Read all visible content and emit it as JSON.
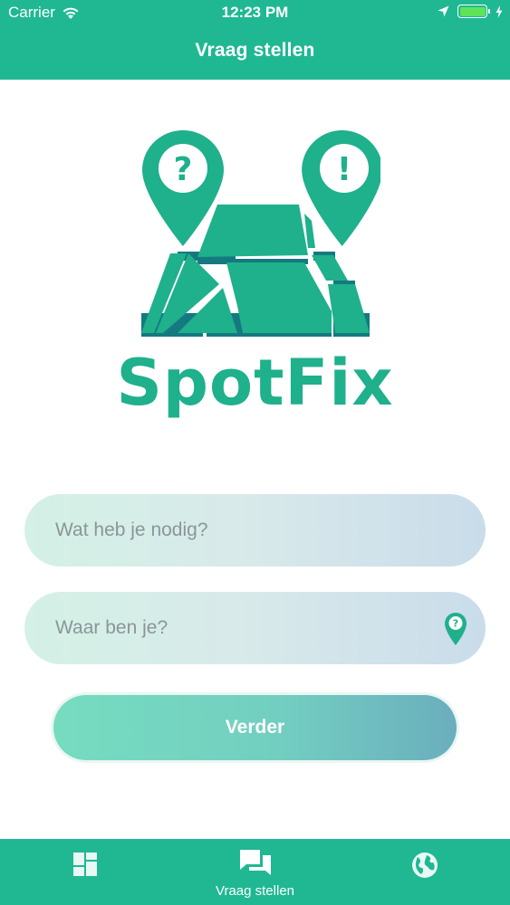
{
  "status_bar": {
    "carrier": "Carrier",
    "time": "12:23 PM",
    "battery_level": 1.0
  },
  "nav": {
    "title": "Vraag stellen"
  },
  "logo": {
    "text": "SpotFix",
    "question_mark": "?",
    "exclamation_mark": "!"
  },
  "form": {
    "need_placeholder": "Wat heb je nodig?",
    "location_placeholder": "Waar ben je?",
    "location_pin_mark": "?",
    "next_label": "Verder"
  },
  "tab_bar": {
    "tabs": [
      {
        "icon": "dashboard-icon",
        "label": ""
      },
      {
        "icon": "chat-bubbles-icon",
        "label": "Vraag stellen",
        "active": true
      },
      {
        "icon": "globe-icon",
        "label": ""
      }
    ]
  },
  "colors": {
    "brand_green": "#1fb893",
    "logo_green": "#1fb08c",
    "logo_dark_edge": "#147a80",
    "field_gradient_start": "#d4f1e6",
    "field_gradient_end": "#c9dcea",
    "button_gradient_start": "#76dcc0",
    "button_gradient_end": "#6baebe"
  }
}
